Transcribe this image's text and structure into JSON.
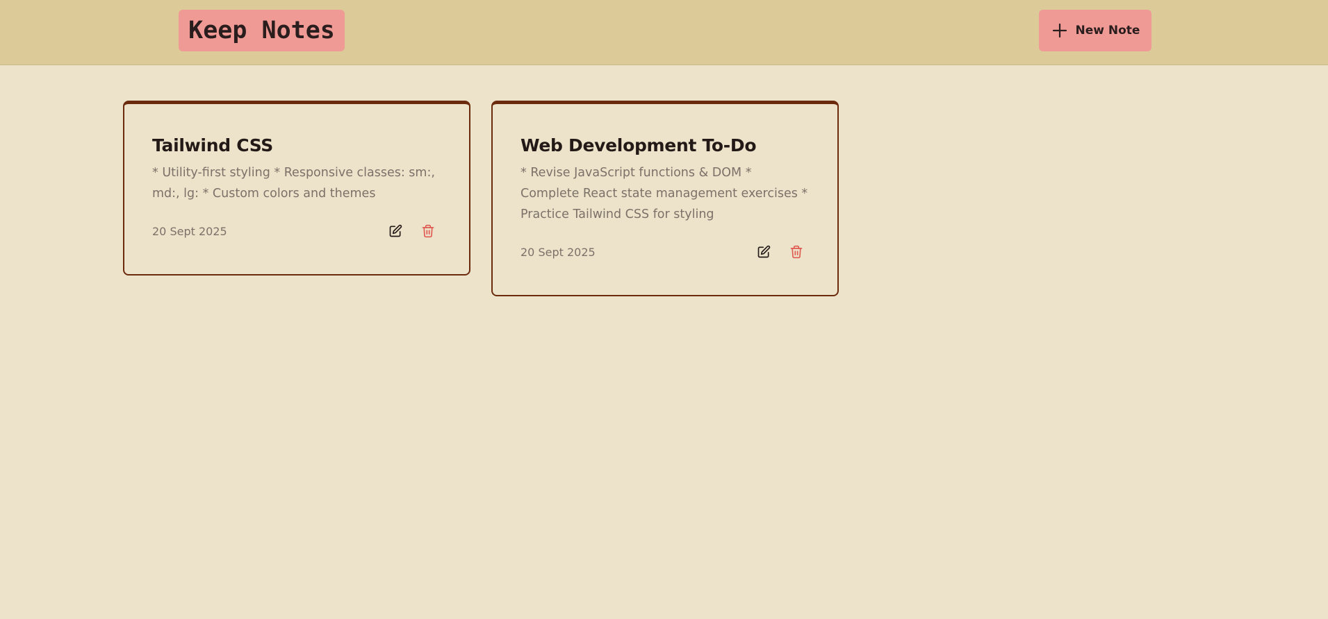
{
  "header": {
    "logo_text": "Keep Notes",
    "new_note_label": "New Note",
    "new_note_icon": "plus-icon"
  },
  "colors": {
    "header_bg": "#dccb99",
    "page_bg": "#ede3cb",
    "accent_pink": "#f09a96",
    "card_border": "#6b2a0c",
    "delete_red": "#e05a52"
  },
  "notes": [
    {
      "title": "Tailwind CSS",
      "body": "* Utility-first styling * Responsive classes: sm:, md:, lg: * Custom colors and themes",
      "date": "20 Sept 2025",
      "edit_icon": "edit-icon",
      "delete_icon": "trash-icon"
    },
    {
      "title": "Web Development To-Do",
      "body": "* Revise JavaScript functions & DOM * Complete React state management exercises * Practice Tailwind CSS for styling",
      "date": "20 Sept 2025",
      "edit_icon": "edit-icon",
      "delete_icon": "trash-icon"
    }
  ]
}
